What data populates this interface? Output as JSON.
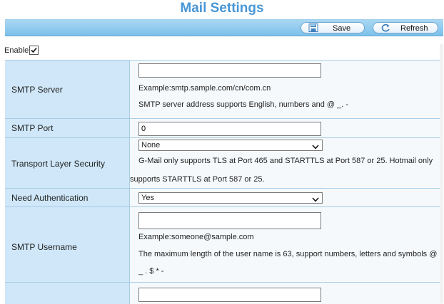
{
  "title": "Mail Settings",
  "toolbar": {
    "save_label": "Save",
    "refresh_label": "Refresh"
  },
  "enable": {
    "label": "Enable",
    "checked": true
  },
  "fields": {
    "smtp_server": {
      "label": "SMTP Server",
      "value": "",
      "note1": "Example:smtp.sample.com/cn/com.cn",
      "note2": "SMTP server address supports English, numbers and @ _. -"
    },
    "smtp_port": {
      "label": "SMTP Port",
      "value": "0"
    },
    "tls": {
      "label": "Transport Layer Security",
      "selected": "None",
      "note_line1": "G-Mail only supports TLS at Port 465 and STARTTLS at Port 587 or 25. Hotmail only",
      "note_line2": "supports STARTTLS at Port 587 or 25."
    },
    "need_auth": {
      "label": "Need Authentication",
      "selected": "Yes"
    },
    "smtp_username": {
      "label": "SMTP Username",
      "value": "",
      "note1": "Example:someone@sample.com",
      "note_line1": "The maximum length of the user name is 63, support numbers, letters and symbols @",
      "note_line2": "_ . $ * -"
    },
    "next_field": {
      "value": ""
    }
  },
  "icons": {
    "save": "floppy-disk-icon",
    "refresh": "refresh-arrow-icon",
    "dropdown": "chevron-down-icon",
    "check": "checkmark-icon"
  },
  "colors": {
    "title": "#4a97d6",
    "toolbar": "#7cc0ea",
    "label_bg": "#cfe7f8",
    "border": "#a7cde6"
  }
}
